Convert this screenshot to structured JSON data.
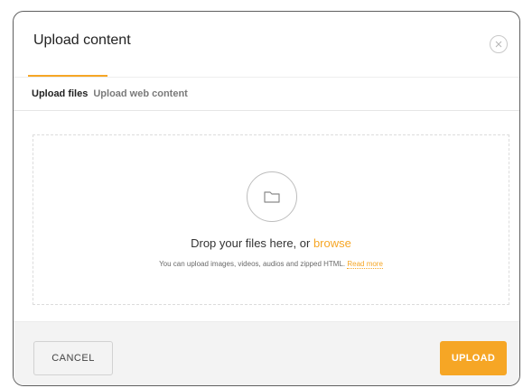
{
  "dialog": {
    "title": "Upload content",
    "close_icon": "close-icon"
  },
  "tabs": [
    {
      "label": "Upload files",
      "active": true
    },
    {
      "label": "Upload web content",
      "active": false
    }
  ],
  "dropzone": {
    "icon": "folder-icon",
    "drop_text": "Drop your files here, or ",
    "browse_label": "browse",
    "help_text": "You can upload images, videos, audios and zipped HTML. ",
    "read_more_label": "Read more"
  },
  "footer": {
    "cancel_label": "CANCEL",
    "upload_label": "UPLOAD"
  },
  "colors": {
    "accent": "#f6a625",
    "border": "#5f5f5f",
    "footer_bg": "#f3f3f3"
  }
}
